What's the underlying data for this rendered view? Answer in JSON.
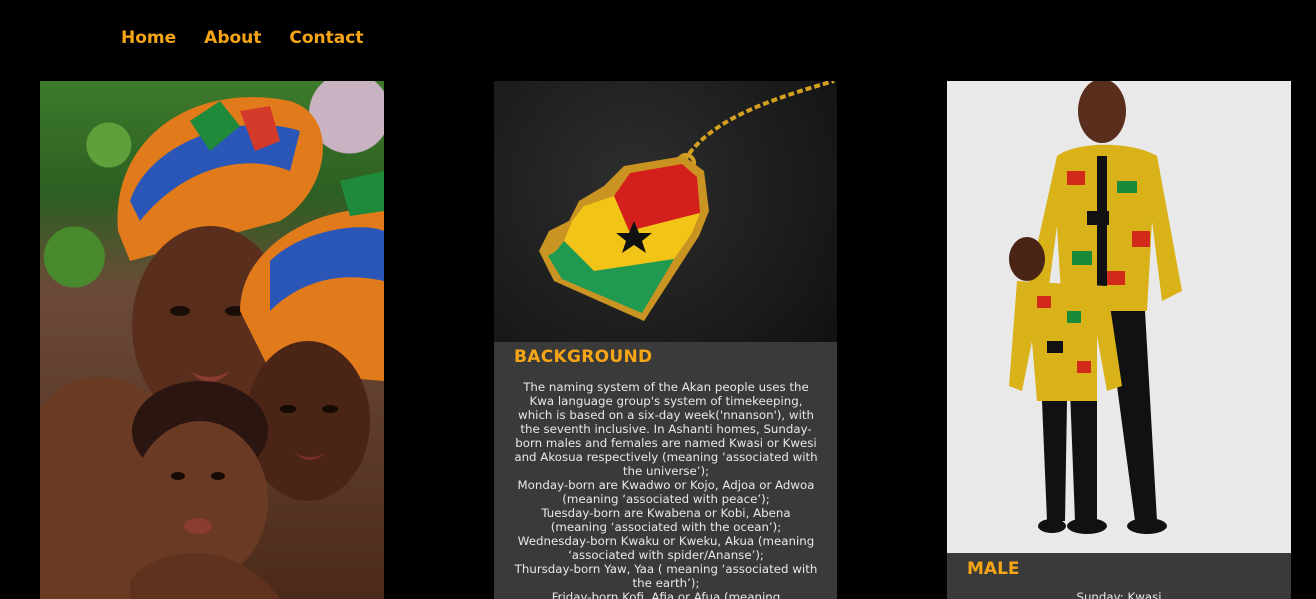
{
  "nav": {
    "items": [
      {
        "label": "Home"
      },
      {
        "label": "About"
      },
      {
        "label": "Contact"
      }
    ]
  },
  "background_card": {
    "heading": "BACKGROUND",
    "paragraphs": [
      "The naming system of the Akan people uses the Kwa language group's system of timekeeping, which is based on a six-day week('nnanson'), with the seventh inclusive. In Ashanti homes, Sunday-born males and females are named Kwasi or Kwesi and Akosua respectively (meaning ‘associated with the universe’);",
      "Monday-born are Kwadwo or Kojo, Adjoa or Adwoa (meaning ‘associated with peace’);",
      "Tuesday-born are Kwabena or Kobi, Abena (meaning ‘associated with the ocean’);",
      "Wednesday-born Kwaku or Kweku, Akua (meaning ‘associated with spider/Ananse’);",
      "Thursday-born Yaw, Yaa ( meaning ‘associated with the earth’);",
      "Friday-born Kofi, Afia or Afua (meaning"
    ]
  },
  "male_card": {
    "heading": "MALE",
    "first_line": "Sunday: Kwasi"
  },
  "colors": {
    "accent": "#f5a516",
    "background": "#000000",
    "card": "#3a3a3a"
  }
}
